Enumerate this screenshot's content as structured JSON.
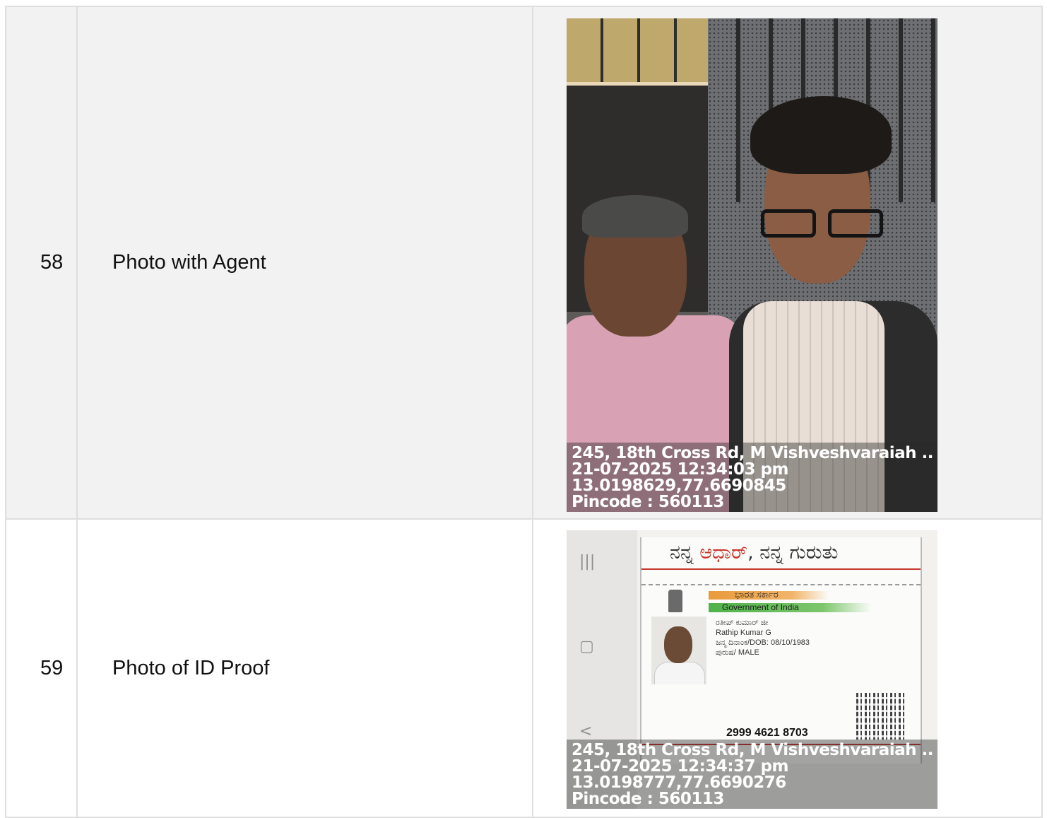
{
  "rows": [
    {
      "number": "58",
      "label": "Photo with Agent",
      "overlay": {
        "address": "245, 18th Cross Rd, M Vishveshvaraiah ...",
        "datetime": "21-07-2025 12:34:03 pm",
        "coords": "13.0198629,77.6690845",
        "pincode": "Pincode : 560113"
      }
    },
    {
      "number": "59",
      "label": "Photo of ID Proof",
      "id_card": {
        "header_kn_prefix": "ನನ್ನ ",
        "header_kn_red": "ಆಧಾರ್",
        "header_kn_suffix": ", ನನ್ನ ಗುರುತು",
        "bharat_sarkar": "ಭಾರತ ಸರ್ಕಾರ",
        "government": "Government of India",
        "name_kn": "ರತೀಪ್ ಕುಮಾರ್ ಜೀ",
        "name_en": "Rathip Kumar G",
        "dob": "ಜನ್ಮ ದಿನಾಂಕ/DOB: 08/10/1983",
        "gender": "ಪುರುಷ/ MALE",
        "uid": "2999 4621 8703"
      },
      "overlay": {
        "address": "245, 18th Cross Rd, M Vishveshvaraiah ...",
        "datetime": "21-07-2025 12:34:37 pm",
        "coords": "13.0198777,77.6690276",
        "pincode": "Pincode : 560113"
      }
    }
  ]
}
